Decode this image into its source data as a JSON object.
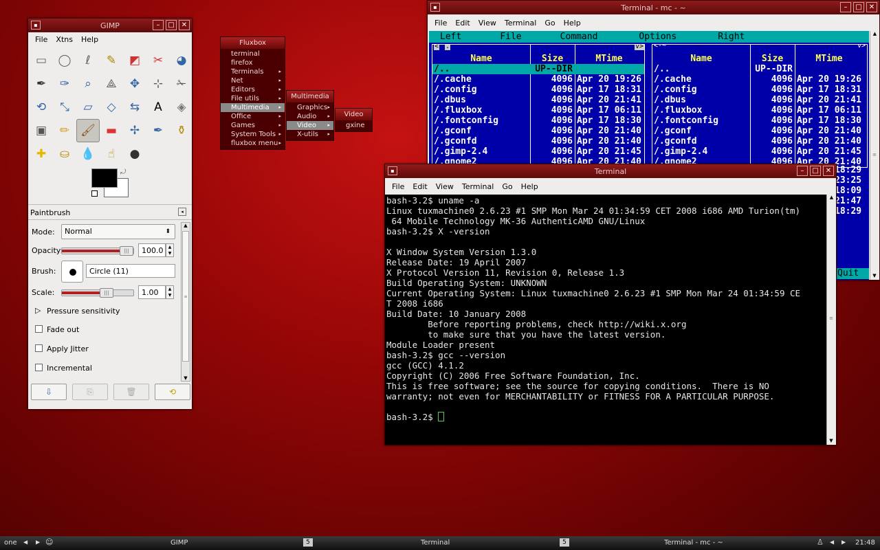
{
  "gimp": {
    "title": "GIMP",
    "menu": [
      "File",
      "Xtns",
      "Help"
    ],
    "tool_icons": [
      "rect-select-icon",
      "ellipse-select-icon",
      "lasso-icon",
      "fuzzy-select-icon",
      "color-select-icon",
      "scissors-icon",
      "foreground-select-icon",
      "paths-icon",
      "color-picker-icon",
      "zoom-icon",
      "measure-icon",
      "move-icon",
      "align-icon",
      "crop-icon",
      "rotate-icon",
      "scale-icon",
      "shear-icon",
      "perspective-icon",
      "flip-icon",
      "text-icon",
      "bucket-fill-icon",
      "blend-icon",
      "pencil-icon",
      "paintbrush-icon",
      "eraser-icon",
      "airbrush-icon",
      "ink-icon",
      "clone-icon",
      "heal-icon",
      "perspective-clone-icon",
      "blur-icon",
      "smudge-icon",
      "dodge-burn-icon"
    ],
    "tool_glyphs": [
      "▭",
      "◯",
      "ℓ",
      "✎",
      "◩",
      "✂",
      "◕",
      "✒",
      "✑",
      "⌕",
      "⟁",
      "✥",
      "⊹",
      "✁",
      "⟲",
      "⤡",
      "▱",
      "◇",
      "⇆",
      "A",
      "◈",
      "▣",
      "✏",
      "🖌",
      "▬",
      "✢",
      "✒",
      "⚱",
      "✚",
      "⛀",
      "💧",
      "☝",
      "●"
    ],
    "paintbrush": {
      "header": "Paintbrush",
      "mode_label": "Mode:",
      "mode_value": "Normal",
      "opacity_label": "Opacity:",
      "opacity_value": "100.0",
      "opacity_level": 1.0,
      "brush_label": "Brush:",
      "brush_value": "Circle (11)",
      "scale_label": "Scale:",
      "scale_value": "1.00",
      "scale_level": 0.55,
      "pressure": "Pressure sensitivity",
      "fade": "Fade out",
      "jitter": "Apply Jitter",
      "incremental": "Incremental"
    }
  },
  "fluxbox": {
    "title": "Fluxbox",
    "items": [
      "terminal",
      "firefox",
      "Terminals",
      "Net",
      "Editors",
      "File utils",
      "Multimedia",
      "Office",
      "Games",
      "System Tools",
      "fluxbox menu"
    ],
    "multimedia": {
      "title": "Multimedia",
      "items": [
        "Graphics",
        "Audio",
        "Video",
        "X-utils"
      ]
    },
    "video": {
      "title": "Video",
      "items": [
        "gxine"
      ]
    }
  },
  "mc": {
    "title": "Terminal - mc - ~",
    "menu": [
      "File",
      "Edit",
      "View",
      "Terminal",
      "Go",
      "Help"
    ],
    "mc_menu": [
      "Left",
      "File",
      "Command",
      "Options",
      "Right"
    ],
    "headers": [
      "Name",
      "Size",
      "MTime"
    ],
    "updir": {
      "name": "/..",
      "size": "UP--DIR",
      "time": ""
    },
    "rows": [
      {
        "name": "/.cache",
        "size": "4096",
        "time": "Apr 20 19:26"
      },
      {
        "name": "/.config",
        "size": "4096",
        "time": "Apr 17 18:31"
      },
      {
        "name": "/.dbus",
        "size": "4096",
        "time": "Apr 20 21:41"
      },
      {
        "name": "/.fluxbox",
        "size": "4096",
        "time": "Apr 17 06:11"
      },
      {
        "name": "/.fontconfig",
        "size": "4096",
        "time": "Apr 17 18:30"
      },
      {
        "name": "/.gconf",
        "size": "4096",
        "time": "Apr 20 21:40"
      },
      {
        "name": "/.gconfd",
        "size": "4096",
        "time": "Apr 20 21:40"
      },
      {
        "name": "/.gimp-2.4",
        "size": "4096",
        "time": "Apr 20 21:45"
      },
      {
        "name": "/.gnome2",
        "size": "4096",
        "time": "Apr 20 21:40"
      }
    ],
    "hidden_times": [
      "18:29",
      "23:25",
      "18:09",
      "21:47",
      "18:29"
    ],
    "quit": "Quit"
  },
  "terminal": {
    "title": "Terminal",
    "menu": [
      "File",
      "Edit",
      "View",
      "Terminal",
      "Go",
      "Help"
    ],
    "lines": [
      "bash-3.2$ uname -a",
      "Linux tuxmachine0 2.6.23 #1 SMP Mon Mar 24 01:34:59 CET 2008 i686 AMD Turion(tm)",
      " 64 Mobile Technology MK-36 AuthenticAMD GNU/Linux",
      "bash-3.2$ X -version",
      "",
      "X Window System Version 1.3.0",
      "Release Date: 19 April 2007",
      "X Protocol Version 11, Revision 0, Release 1.3",
      "Build Operating System: UNKNOWN",
      "Current Operating System: Linux tuxmachine0 2.6.23 #1 SMP Mon Mar 24 01:34:59 CE",
      "T 2008 i686",
      "Build Date: 10 January 2008",
      "        Before reporting problems, check http://wiki.x.org",
      "        to make sure that you have the latest version.",
      "Module Loader present",
      "bash-3.2$ gcc --version",
      "gcc (GCC) 4.1.2",
      "Copyright (C) 2006 Free Software Foundation, Inc.",
      "This is free software; see the source for copying conditions.  There is NO",
      "warranty; not even for MERCHANTABILITY or FITNESS FOR A PARTICULAR PURPOSE.",
      ""
    ],
    "prompt": "bash-3.2$ "
  },
  "taskbar": {
    "workspace": "one",
    "tasks": [
      "GIMP",
      "Terminal",
      "Terminal - mc - ~"
    ],
    "clock": "21:48"
  }
}
